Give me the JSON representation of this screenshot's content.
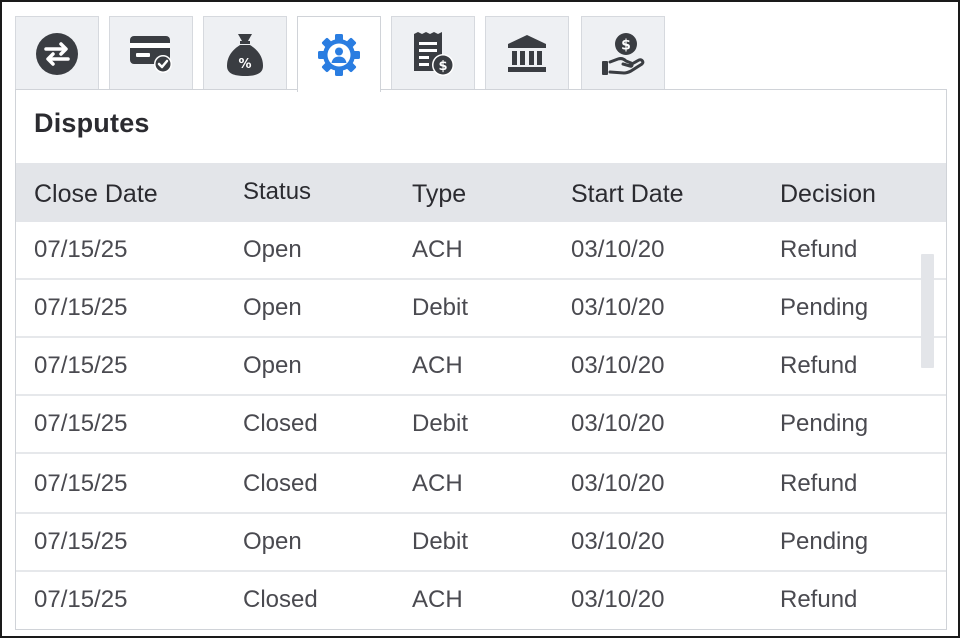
{
  "tabs": [
    {
      "name": "transfer-icon",
      "active": false
    },
    {
      "name": "card-verified-icon",
      "active": false
    },
    {
      "name": "money-bag-percent-icon",
      "active": false
    },
    {
      "name": "user-gear-icon",
      "active": true
    },
    {
      "name": "invoice-dollar-icon",
      "active": false
    },
    {
      "name": "bank-icon",
      "active": false
    },
    {
      "name": "hand-dollar-icon",
      "active": false
    }
  ],
  "colors": {
    "active_icon": "#2a7de1",
    "inactive_icon": "#3a3d42",
    "header_bg": "#e3e5e9"
  },
  "panel": {
    "title": "Disputes"
  },
  "table": {
    "columns": [
      "Close Date",
      "Status",
      "Type",
      "Start Date",
      "Decision"
    ],
    "rows": [
      [
        "07/15/25",
        "Open",
        "ACH",
        "03/10/20",
        "Refund"
      ],
      [
        "07/15/25",
        "Open",
        "Debit",
        "03/10/20",
        "Pending"
      ],
      [
        "07/15/25",
        "Open",
        "ACH",
        "03/10/20",
        "Refund"
      ],
      [
        "07/15/25",
        "Closed",
        "Debit",
        "03/10/20",
        "Pending"
      ],
      [
        "07/15/25",
        "Closed",
        "ACH",
        "03/10/20",
        "Refund"
      ],
      [
        "07/15/25",
        "Open",
        "Debit",
        "03/10/20",
        "Pending"
      ],
      [
        "07/15/25",
        "Closed",
        "ACH",
        "03/10/20",
        "Refund"
      ]
    ]
  }
}
